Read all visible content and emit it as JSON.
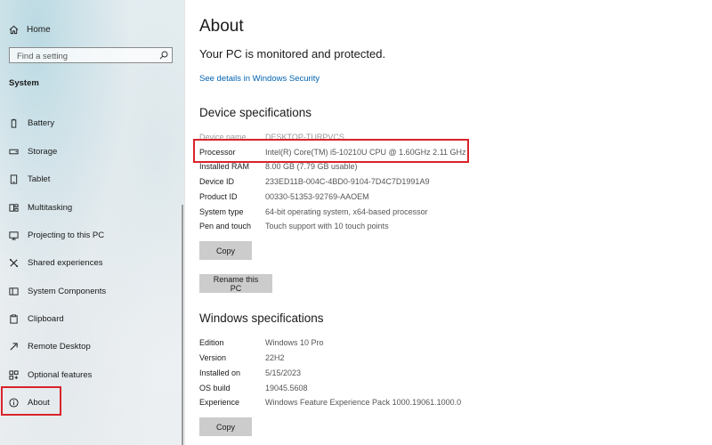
{
  "sidebar": {
    "home_label": "Home",
    "search_placeholder": "Find a setting",
    "section_label": "System",
    "items": [
      {
        "label": "Battery",
        "icon": "battery-icon"
      },
      {
        "label": "Storage",
        "icon": "storage-icon"
      },
      {
        "label": "Tablet",
        "icon": "tablet-icon"
      },
      {
        "label": "Multitasking",
        "icon": "multitasking-icon"
      },
      {
        "label": "Projecting to this PC",
        "icon": "projecting-icon"
      },
      {
        "label": "Shared experiences",
        "icon": "shared-experiences-icon"
      },
      {
        "label": "System Components",
        "icon": "system-components-icon"
      },
      {
        "label": "Clipboard",
        "icon": "clipboard-icon"
      },
      {
        "label": "Remote Desktop",
        "icon": "remote-desktop-icon"
      },
      {
        "label": "Optional features",
        "icon": "optional-features-icon"
      },
      {
        "label": "About",
        "icon": "info-icon"
      }
    ]
  },
  "main": {
    "title": "About",
    "protection_status": "Your PC is monitored and protected.",
    "security_link": "See details in Windows Security",
    "device_specs": {
      "heading": "Device specifications",
      "rows": [
        {
          "key": "Device name",
          "value": "DESKTOP-TURPVCS"
        },
        {
          "key": "Processor",
          "value": "Intel(R) Core(TM) i5-10210U CPU @ 1.60GHz   2.11 GHz"
        },
        {
          "key": "Installed RAM",
          "value": "8.00 GB (7.79 GB usable)"
        },
        {
          "key": "Device ID",
          "value": "233ED11B-004C-4BD0-9104-7D4C7D1991A9"
        },
        {
          "key": "Product ID",
          "value": "00330-51353-92769-AAOEM"
        },
        {
          "key": "System type",
          "value": "64-bit operating system, x64-based processor"
        },
        {
          "key": "Pen and touch",
          "value": "Touch support with 10 touch points"
        }
      ],
      "copy_button": "Copy",
      "rename_button": "Rename this PC"
    },
    "windows_specs": {
      "heading": "Windows specifications",
      "rows": [
        {
          "key": "Edition",
          "value": "Windows 10 Pro"
        },
        {
          "key": "Version",
          "value": "22H2"
        },
        {
          "key": "Installed on",
          "value": "5/15/2023"
        },
        {
          "key": "OS build",
          "value": "19045.5608"
        },
        {
          "key": "Experience",
          "value": "Windows Feature Experience Pack 1000.19061.1000.0"
        }
      ],
      "copy_button": "Copy"
    }
  },
  "colors": {
    "highlight_border": "#d8242a",
    "link": "#0063b1",
    "button_bg": "#cccccc"
  }
}
